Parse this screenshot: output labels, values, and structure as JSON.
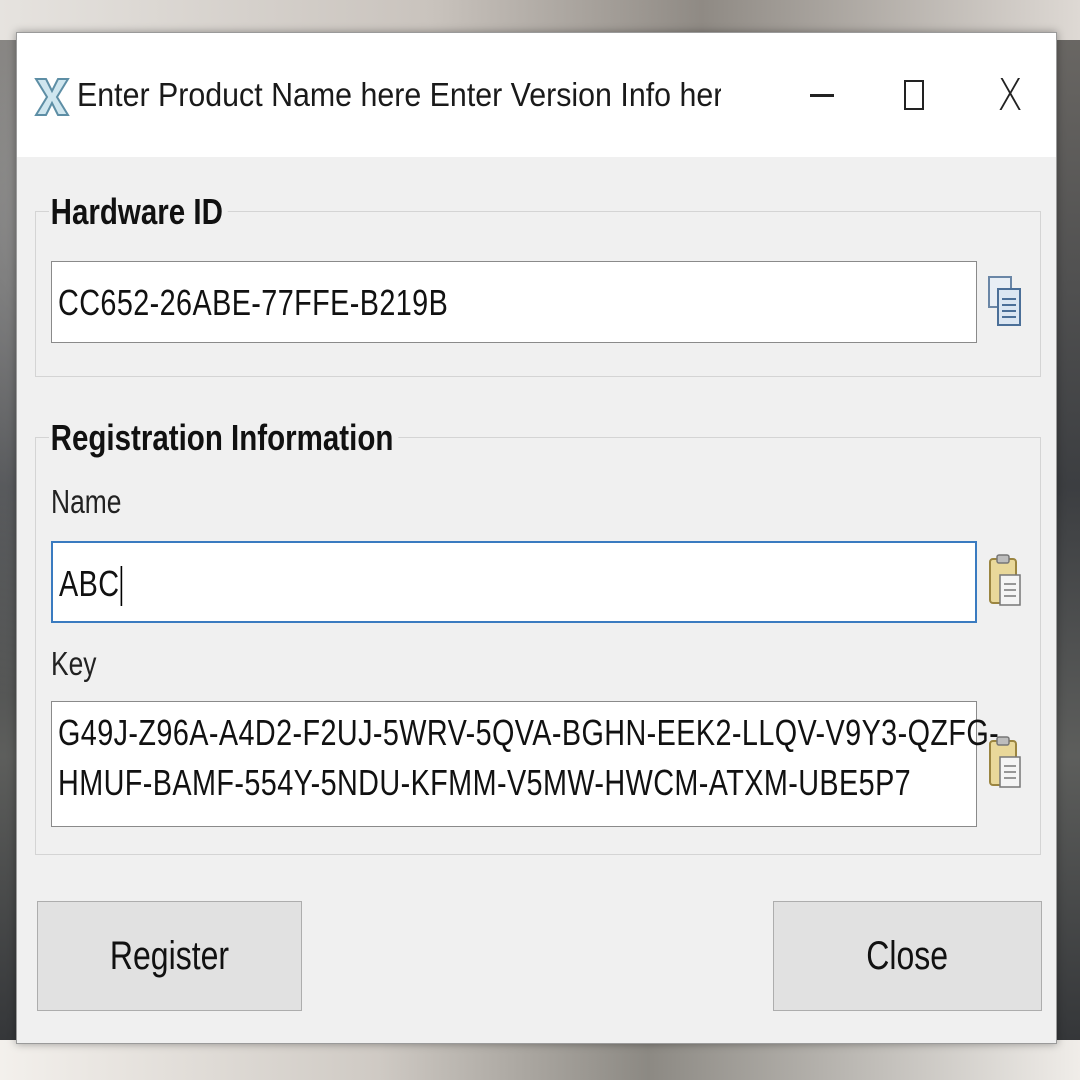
{
  "window": {
    "title": "Enter Product Name here Enter Version Info here Regi...",
    "app_icon": "app-x-icon",
    "controls": {
      "minimize": "minimize-icon",
      "maximize": "maximize-icon",
      "close": "close-x-icon",
      "close_glyph": "X"
    }
  },
  "hardware_group": {
    "legend": "Hardware ID",
    "hardware_id_value": "CC652-26ABE-77FFE-B219B",
    "copy_icon": "copy-icon"
  },
  "registration_group": {
    "legend": "Registration Information",
    "name_label": "Name",
    "name_value": "ABC",
    "key_label": "Key",
    "key_line1": "G49J-Z96A-A4D2-F2UJ-5WRV-5QVA-BGHN-EEK2-LLQV-V9Y3-QZFG-",
    "key_line2": "HMUF-BAMF-554Y-5NDU-KFMM-V5MW-HWCM-ATXM-UBE5P7",
    "paste_icon": "paste-icon"
  },
  "buttons": {
    "register_label": "Register",
    "close_label": "Close"
  },
  "colors": {
    "focus_border": "#3a7bc0",
    "window_bg": "#f0f0f0",
    "button_bg": "#e1e1e1"
  }
}
